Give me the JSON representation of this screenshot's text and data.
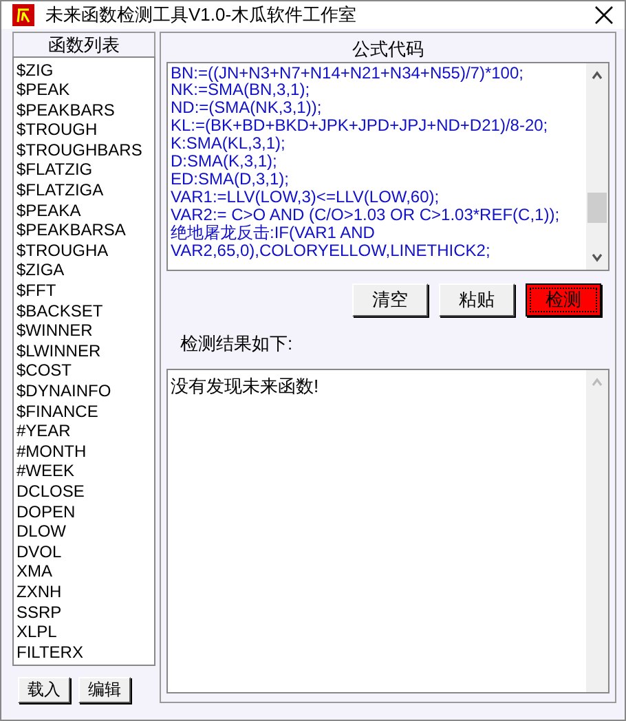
{
  "window": {
    "title": "未来函数检测工具V1.0-木瓜软件工作室"
  },
  "function_list": {
    "header": "函数列表",
    "items": [
      "$ZIG",
      "$PEAK",
      "$PEAKBARS",
      "$TROUGH",
      "$TROUGHBARS",
      "$FLATZIG",
      "$FLATZIGA",
      "$PEAKA",
      "$PEAKBARSA",
      "$TROUGHA",
      "$ZIGA",
      "$FFT",
      "$BACKSET",
      "$WINNER",
      "$LWINNER",
      "$COST",
      "$DYNAINFO",
      "$FINANCE",
      "#YEAR",
      "#MONTH",
      "#WEEK",
      "DCLOSE",
      "DOPEN",
      "DLOW",
      "DVOL",
      "XMA",
      "ZXNH",
      "SSRP",
      "XLPL",
      "FILTERX"
    ],
    "buttons": [
      "载入",
      "编辑"
    ]
  },
  "formula": {
    "header": "公式代码",
    "lines": [
      "BN:=((JN+N3+N7+N14+N21+N34+N55)/7)*100;",
      "NK:=SMA(BN,3,1);",
      "ND:=(SMA(NK,3,1));",
      "KL:=(BK+BD+BKD+JPK+JPD+JPJ+ND+D21)/8-20;",
      "K:SMA(KL,3,1);",
      "D:SMA(K,3,1);",
      "ED:SMA(D,3,1);",
      "VAR1:=LLV(LOW,3)<=LLV(LOW,60);",
      "VAR2:= C>O AND (C/O>1.03 OR C>1.03*REF(C,1));",
      "绝地屠龙反击:IF(VAR1 AND",
      "VAR2,65,0),COLORYELLOW,LINETHICK2;"
    ],
    "buttons": [
      {
        "label": "清空",
        "kind": "normal"
      },
      {
        "label": "粘贴",
        "kind": "normal"
      },
      {
        "label": "检测",
        "kind": "highlight"
      }
    ]
  },
  "result": {
    "label": "检测结果如下:",
    "text": "没有发现未来函数!"
  }
}
